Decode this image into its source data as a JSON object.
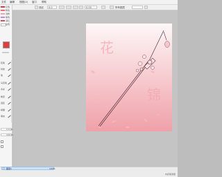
{
  "menubar": {
    "items": [
      {
        "label": "文件"
      },
      {
        "label": "编辑"
      },
      {
        "label": "视图(V)"
      },
      {
        "label": "窗口"
      },
      {
        "label": "帮助"
      }
    ]
  },
  "toolbar": {
    "tool_label": "选区",
    "zoom_value": "0.0",
    "rotate_value": "0.00",
    "mode_label": "所有图层",
    "chips": [
      "",
      "",
      "",
      ""
    ]
  },
  "palette": {
    "swatches": [
      {
        "color": "#e8303c",
        "label": "红色"
      },
      {
        "color": "#f06a7a",
        "label": "粉色"
      },
      {
        "color": "#f7a0b0",
        "label": "浅粉"
      },
      {
        "color": "#c08ad8",
        "label": "紫色"
      },
      {
        "color": "#d94b5c",
        "label": "深红"
      },
      {
        "color": "#ffffff",
        "label": "白色"
      }
    ],
    "foreground": "#e63b3b",
    "background": "#ffffff"
  },
  "brushes": {
    "items": [
      {
        "label": "铅笔"
      },
      {
        "label": "喷枪"
      },
      {
        "label": "笔"
      },
      {
        "label": "马克笔"
      },
      {
        "label": "水彩"
      },
      {
        "label": "橡皮"
      },
      {
        "label": "选区"
      },
      {
        "label": "模糊"
      },
      {
        "label": "填充"
      }
    ]
  },
  "brush_settings": {
    "size_value": "2.0 px",
    "density_value": "100 px"
  },
  "artwork": {
    "big_char_1": "花",
    "big_char_2": "锦",
    "bg_top": "#fdf7f7",
    "bg_bottom": "#f0a0a8"
  },
  "layers": {
    "active_name": "图层1",
    "opacity": "100%"
  },
  "status": {
    "memory": "内存使用量"
  }
}
